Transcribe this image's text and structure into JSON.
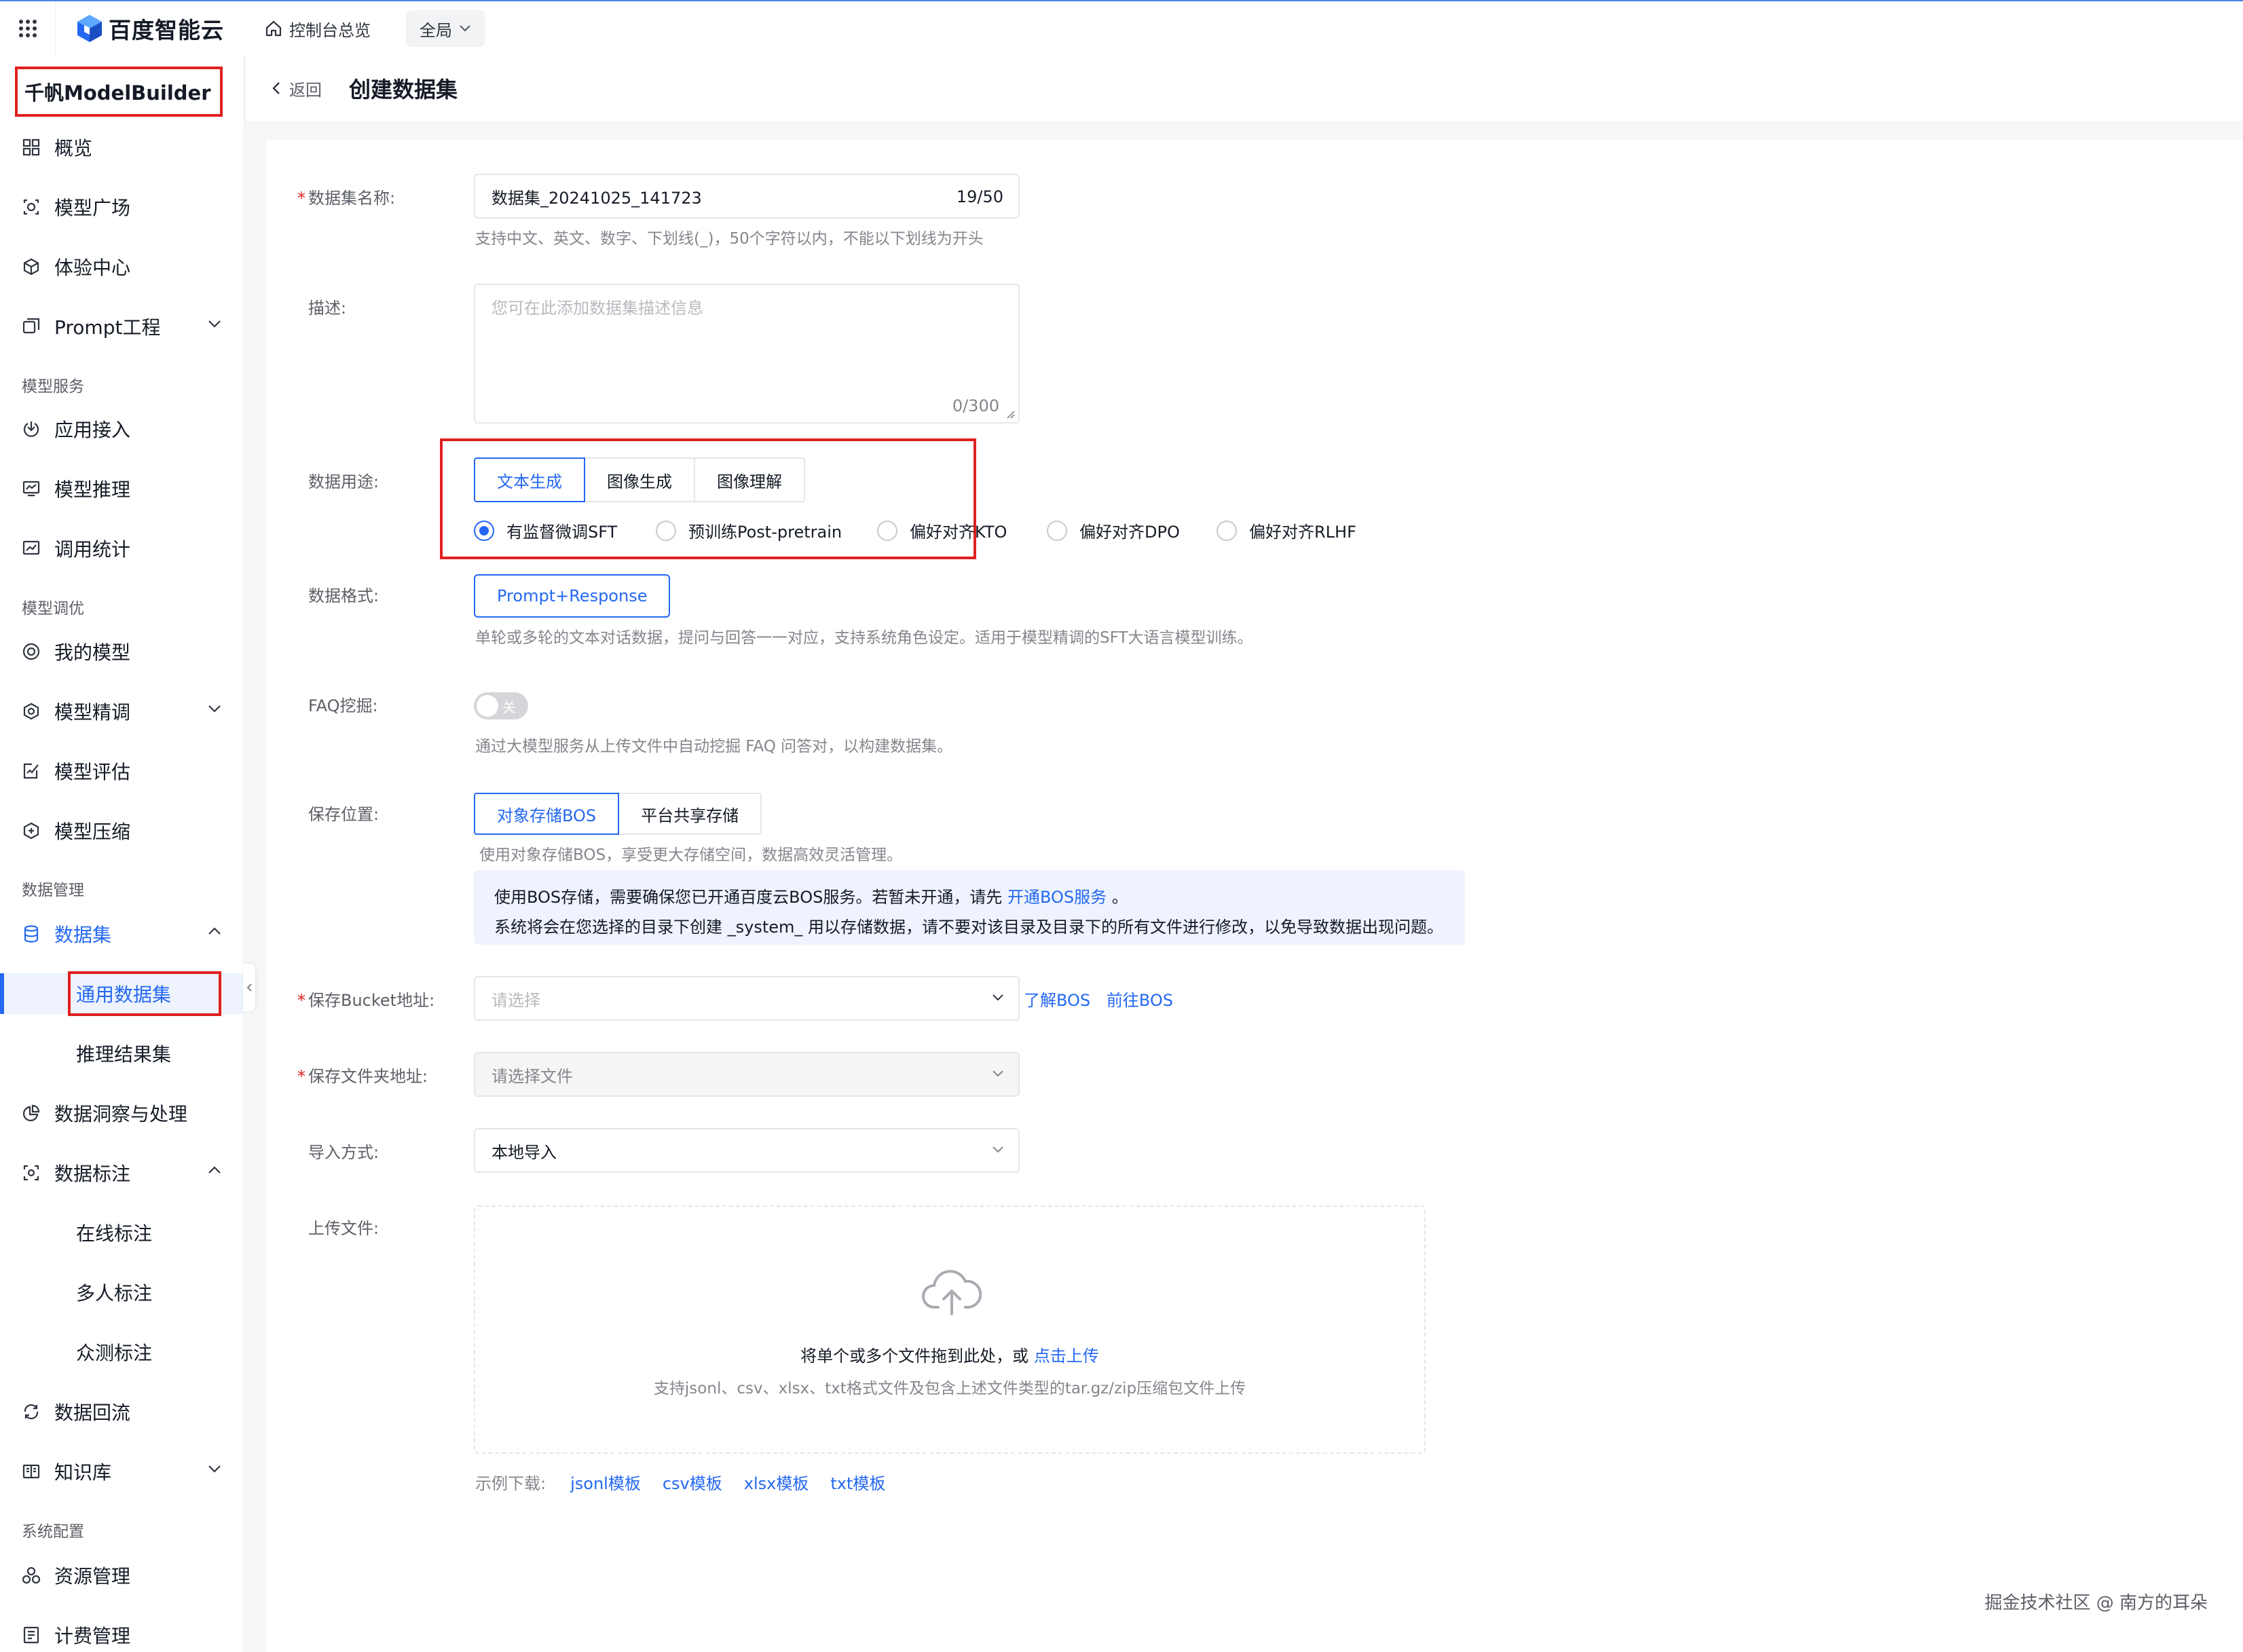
{
  "topbar": {
    "brand": "百度智能云",
    "home_link": "控制台总览",
    "scope": "全局"
  },
  "sidebar": {
    "product": "千帆ModelBuilder",
    "items_top": [
      "概览",
      "模型广场",
      "体验中心",
      "Prompt工程"
    ],
    "section_model_service": "模型服务",
    "items_service": [
      "应用接入",
      "模型推理",
      "调用统计"
    ],
    "section_model_tuning": "模型调优",
    "items_tuning": [
      "我的模型",
      "模型精调",
      "模型评估",
      "模型压缩"
    ],
    "section_data": "数据管理",
    "dataset": "数据集",
    "dataset_children": [
      "通用数据集",
      "推理结果集"
    ],
    "data_insight": "数据洞察与处理",
    "annotation": "数据标注",
    "annotation_children": [
      "在线标注",
      "多人标注",
      "众测标注"
    ],
    "data_reflow": "数据回流",
    "knowledge": "知识库",
    "section_system": "系统配置",
    "items_system": [
      "资源管理",
      "计费管理"
    ]
  },
  "header": {
    "back": "返回",
    "title": "创建数据集"
  },
  "form": {
    "name": {
      "label": "数据集名称:",
      "value": "数据集_20241025_141723",
      "count": "19/50",
      "hint": "支持中文、英文、数字、下划线(_)，50个字符以内，不能以下划线为开头"
    },
    "description": {
      "label": "描述:",
      "placeholder": "您可在此添加数据集描述信息",
      "count": "0/300"
    },
    "usage": {
      "label": "数据用途:",
      "tabs": [
        "文本生成",
        "图像生成",
        "图像理解"
      ],
      "radios": [
        "有监督微调SFT",
        "预训练Post-pretrain",
        "偏好对齐KTO",
        "偏好对齐DPO",
        "偏好对齐RLHF"
      ]
    },
    "format": {
      "label": "数据格式:",
      "button": "Prompt+Response",
      "hint": "单轮或多轮的文本对话数据，提问与回答一一对应，支持系统角色设定。适用于模型精调的SFT大语言模型训练。"
    },
    "faq": {
      "label": "FAQ挖掘:",
      "switch_text": "关",
      "hint": "通过大模型服务从上传文件中自动挖掘 FAQ 问答对，以构建数据集。"
    },
    "storage": {
      "label": "保存位置:",
      "tabs": [
        "对象存储BOS",
        "平台共享存储"
      ],
      "hint": "使用对象存储BOS，享受更大存储空间，数据高效灵活管理。",
      "info_line1_a": "使用BOS存储，需要确保您已开通百度云BOS服务。若暂未开通，请先 ",
      "info_line1_link": "开通BOS服务",
      "info_line1_b": " 。",
      "info_line2": "系统将会在您选择的目录下创建 _system_ 用以存储数据，请不要对该目录及目录下的所有文件进行修改，以免导致数据出现问题。"
    },
    "bucket": {
      "label": "保存Bucket地址:",
      "placeholder": "请选择",
      "link1": "了解BOS",
      "link2": "前往BOS"
    },
    "folder": {
      "label": "保存文件夹地址:",
      "placeholder": "请选择文件"
    },
    "import": {
      "label": "导入方式:",
      "value": "本地导入"
    },
    "upload": {
      "label": "上传文件:",
      "main_text": "将单个或多个文件拖到此处，或 ",
      "main_link": "点击上传",
      "sub_text": "支持jsonl、csv、xlsx、txt格式文件及包含上述文件类型的tar.gz/zip压缩包文件上传"
    },
    "samples": {
      "label": "示例下载:",
      "links": [
        "jsonl模板",
        "csv模板",
        "xlsx模板",
        "txt模板"
      ]
    }
  },
  "watermark": "掘金技术社区 @ 南方的耳朵",
  "colors": {
    "accent": "#2468f2",
    "highlight": "#e02020"
  }
}
